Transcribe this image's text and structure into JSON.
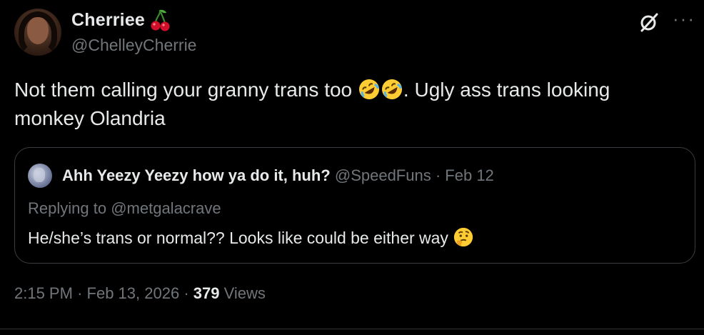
{
  "author": {
    "display_name": "Cherriee",
    "handle": "@ChelleyCherrie",
    "badge_icon": "cherry-icon"
  },
  "tweet": {
    "text_part1": "Not them calling your granny trans too ",
    "text_part2": ". Ugly ass trans looking monkey Olandria",
    "emojis": [
      "rolling-on-floor-laughing-emoji",
      "rolling-on-floor-laughing-emoji"
    ]
  },
  "quote": {
    "author_name": "Ahh Yeezy Yeezy how ya do it, huh?",
    "author_handle": "@SpeedFuns",
    "separator": "·",
    "date": "Feb 12",
    "replying_to_prefix": "Replying to",
    "replying_to_handle": "@metgalacrave",
    "text": "He/she’s trans or normal?? Looks like could be either way",
    "emoji": "thinking-face-emoji"
  },
  "footer": {
    "time": "2:15 PM",
    "separator": "·",
    "date": "Feb 13, 2026",
    "views_count": "379",
    "views_label": "Views"
  },
  "icons": {
    "top_right": [
      "grok-icon",
      "more-icon"
    ]
  },
  "colors": {
    "background": "#000000",
    "primary_text": "#e7e9ea",
    "secondary_text": "#71767b",
    "border": "#3a3d41"
  }
}
